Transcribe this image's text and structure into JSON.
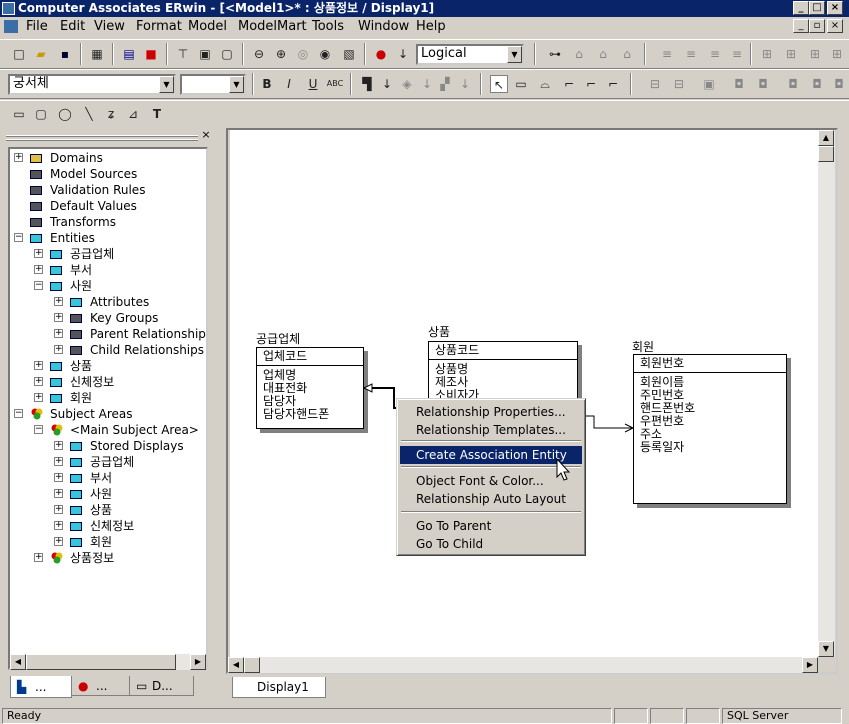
{
  "window": {
    "title": "Computer Associates ERwin - [<Model1>* : 상품정보 / Display1]"
  },
  "menu": [
    "File",
    "Edit",
    "View",
    "Format",
    "Model",
    "ModelMart",
    "Tools",
    "Window",
    "Help"
  ],
  "toolbar": {
    "view_mode": "Logical",
    "font_name": "궁서체",
    "font_size": ""
  },
  "tree": {
    "items": [
      {
        "label": "Domains",
        "level": 0,
        "expander": "+",
        "icon": "domains-icon"
      },
      {
        "label": "Model Sources",
        "level": 0,
        "expander": "",
        "icon": "model-sources-icon"
      },
      {
        "label": "Validation Rules",
        "level": 0,
        "expander": "",
        "icon": "validation-rules-icon"
      },
      {
        "label": "Default Values",
        "level": 0,
        "expander": "",
        "icon": "default-values-icon"
      },
      {
        "label": "Transforms",
        "level": 0,
        "expander": "",
        "icon": "transforms-icon"
      },
      {
        "label": "Entities",
        "level": 0,
        "expander": "-",
        "icon": "entities-icon"
      },
      {
        "label": "공급업체",
        "level": 1,
        "expander": "+",
        "icon": "entity-icon"
      },
      {
        "label": "부서",
        "level": 1,
        "expander": "+",
        "icon": "entity-icon"
      },
      {
        "label": "사원",
        "level": 1,
        "expander": "-",
        "icon": "entity-icon"
      },
      {
        "label": "Attributes",
        "level": 2,
        "expander": "+",
        "icon": "attributes-icon"
      },
      {
        "label": "Key Groups",
        "level": 2,
        "expander": "+",
        "icon": "key-groups-icon"
      },
      {
        "label": "Parent Relationships",
        "level": 2,
        "expander": "+",
        "icon": "parent-relationships-icon"
      },
      {
        "label": "Child Relationships",
        "level": 2,
        "expander": "+",
        "icon": "child-relationships-icon"
      },
      {
        "label": "상품",
        "level": 1,
        "expander": "+",
        "icon": "entity-icon"
      },
      {
        "label": "신체정보",
        "level": 1,
        "expander": "+",
        "icon": "entity-icon"
      },
      {
        "label": "회원",
        "level": 1,
        "expander": "+",
        "icon": "entity-icon"
      },
      {
        "label": "Subject Areas",
        "level": 0,
        "expander": "-",
        "icon": "subject-area-icon"
      },
      {
        "label": "<Main Subject Area>",
        "level": 1,
        "expander": "-",
        "icon": "subject-area-icon"
      },
      {
        "label": "Stored Displays",
        "level": 2,
        "expander": "+",
        "icon": "stored-displays-icon"
      },
      {
        "label": "공급업체",
        "level": 2,
        "expander": "+",
        "icon": "entity-icon"
      },
      {
        "label": "부서",
        "level": 2,
        "expander": "+",
        "icon": "entity-icon"
      },
      {
        "label": "사원",
        "level": 2,
        "expander": "+",
        "icon": "entity-icon"
      },
      {
        "label": "상품",
        "level": 2,
        "expander": "+",
        "icon": "entity-icon"
      },
      {
        "label": "신체정보",
        "level": 2,
        "expander": "+",
        "icon": "entity-icon"
      },
      {
        "label": "회원",
        "level": 2,
        "expander": "+",
        "icon": "entity-icon"
      },
      {
        "label": "상품정보",
        "level": 1,
        "expander": "+",
        "icon": "subject-area-icon"
      }
    ]
  },
  "panel_tabs": [
    "...",
    "...",
    "D..."
  ],
  "entities": {
    "supplier": {
      "name": "공급업체",
      "key": "업체코드",
      "attrs": [
        "업체명",
        "대표전화",
        "담당자",
        "담당자핸드폰"
      ]
    },
    "product": {
      "name": "상품",
      "key": "상품코드",
      "attrs": [
        "상품명",
        "제조사",
        "소비자가"
      ]
    },
    "member": {
      "name": "회원",
      "key": "회원번호",
      "attrs": [
        "회원이름",
        "주민번호",
        "핸드폰번호",
        "우편번호",
        "주소",
        "등록일자"
      ]
    }
  },
  "context_menu": {
    "items": [
      {
        "label": "Relationship Properties...",
        "highlighted": false
      },
      {
        "label": "Relationship Templates...",
        "highlighted": false
      },
      {
        "label": "Create Association Entity",
        "highlighted": true
      },
      {
        "label": "Object Font & Color...",
        "highlighted": false
      },
      {
        "label": "Relationship Auto Layout",
        "highlighted": false
      },
      {
        "label": "Go To Parent",
        "highlighted": false
      },
      {
        "label": "Go To Child",
        "highlighted": false
      }
    ]
  },
  "display_tab": "Display1",
  "status": {
    "text": "Ready",
    "target": "SQL Server"
  },
  "colors": {
    "titlebar": "#0a246a",
    "face": "#d4d0c8",
    "highlight": "#0a246a",
    "entity_icon": "#35c7d8"
  }
}
